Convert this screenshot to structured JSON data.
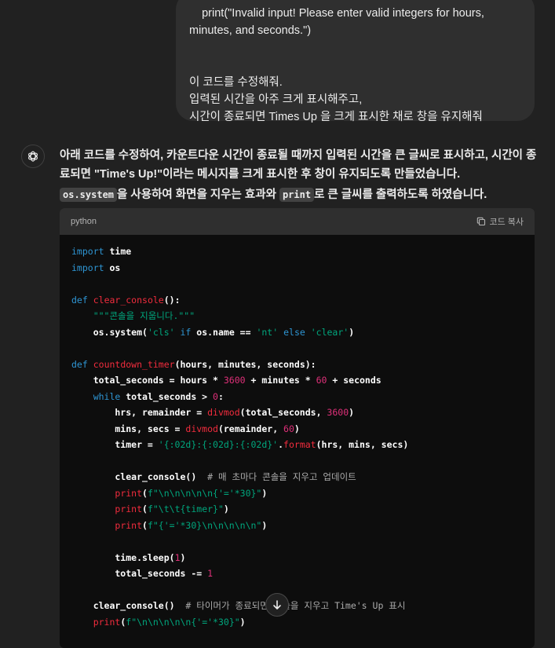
{
  "user_message": {
    "lines": [
      "    print(\"Invalid input! Please enter valid integers for hours,",
      "minutes, and seconds.\")",
      "",
      "",
      "이 코드를 수정해줘.",
      "입력된 시간을 아주 크게 표시해주고,",
      "시간이 종료되면 Times Up 을 크게 표시한 채로 창을 유지해줘"
    ]
  },
  "assistant": {
    "avatar_icon": "openai-logo-icon",
    "para1": "아래 코드를 수정하여, 카운트다운 시간이 종료될 때까지 입력된 시간을 큰 글씨로 표시하고, 시간이 종료되면 \"Time's Up!\"이라는 메시지를 크게 표시한 후 창이 유지되도록 만들었습니다.",
    "para2_code1": "os.system",
    "para2_text1": "을 사용하여 화면을 지우는 효과와 ",
    "para2_code2": "print",
    "para2_text2": "로 큰 글씨를 출력하도록 하였습니다."
  },
  "code_block": {
    "language": "python",
    "copy_label": "코드 복사",
    "lines": [
      [
        [
          "kw",
          "import"
        ],
        [
          "txt",
          " time"
        ]
      ],
      [
        [
          "kw",
          "import"
        ],
        [
          "txt",
          " os"
        ]
      ],
      [],
      [
        [
          "kw",
          "def"
        ],
        [
          "txt",
          " "
        ],
        [
          "fn",
          "clear_console"
        ],
        [
          "txt",
          "():"
        ]
      ],
      [
        [
          "txt",
          "    "
        ],
        [
          "str",
          "\"\"\"콘솔을 지웁니다.\"\"\""
        ]
      ],
      [
        [
          "txt",
          "    os.system("
        ],
        [
          "str",
          "'cls'"
        ],
        [
          "txt",
          " "
        ],
        [
          "kw",
          "if"
        ],
        [
          "txt",
          " os.name == "
        ],
        [
          "str",
          "'nt'"
        ],
        [
          "txt",
          " "
        ],
        [
          "kw",
          "else"
        ],
        [
          "txt",
          " "
        ],
        [
          "str",
          "'clear'"
        ],
        [
          "txt",
          ")"
        ]
      ],
      [],
      [
        [
          "kw",
          "def"
        ],
        [
          "txt",
          " "
        ],
        [
          "fn",
          "countdown_timer"
        ],
        [
          "txt",
          "(hours, minutes, seconds):"
        ]
      ],
      [
        [
          "txt",
          "    total_seconds = hours * "
        ],
        [
          "num",
          "3600"
        ],
        [
          "txt",
          " + minutes * "
        ],
        [
          "num",
          "60"
        ],
        [
          "txt",
          " + seconds"
        ]
      ],
      [
        [
          "txt",
          "    "
        ],
        [
          "kw",
          "while"
        ],
        [
          "txt",
          " total_seconds > "
        ],
        [
          "num",
          "0"
        ],
        [
          "txt",
          ":"
        ]
      ],
      [
        [
          "txt",
          "        hrs, remainder = "
        ],
        [
          "fn",
          "divmod"
        ],
        [
          "txt",
          "(total_seconds, "
        ],
        [
          "num",
          "3600"
        ],
        [
          "txt",
          ")"
        ]
      ],
      [
        [
          "txt",
          "        mins, secs = "
        ],
        [
          "fn",
          "divmod"
        ],
        [
          "txt",
          "(remainder, "
        ],
        [
          "num",
          "60"
        ],
        [
          "txt",
          ")"
        ]
      ],
      [
        [
          "txt",
          "        timer = "
        ],
        [
          "str",
          "'{:02d}:{:02d}:{:02d}'"
        ],
        [
          "txt",
          "."
        ],
        [
          "fn",
          "format"
        ],
        [
          "txt",
          "(hrs, mins, secs)"
        ]
      ],
      [],
      [
        [
          "txt",
          "        clear_console()  "
        ],
        [
          "cm",
          "# 매 초마다 콘솔을 지우고 업데이트"
        ]
      ],
      [
        [
          "txt",
          "        "
        ],
        [
          "fn",
          "print"
        ],
        [
          "txt",
          "("
        ],
        [
          "str",
          "f\"\\n\\n\\n\\n\\n{'='*30}\""
        ],
        [
          "txt",
          ")"
        ]
      ],
      [
        [
          "txt",
          "        "
        ],
        [
          "fn",
          "print"
        ],
        [
          "txt",
          "("
        ],
        [
          "str",
          "f\"\\t\\t{timer}\""
        ],
        [
          "txt",
          ")"
        ]
      ],
      [
        [
          "txt",
          "        "
        ],
        [
          "fn",
          "print"
        ],
        [
          "txt",
          "("
        ],
        [
          "str",
          "f\"{'='*30}\\n\\n\\n\\n\\n\""
        ],
        [
          "txt",
          ")"
        ]
      ],
      [],
      [
        [
          "txt",
          "        time.sleep("
        ],
        [
          "num",
          "1"
        ],
        [
          "txt",
          ")"
        ]
      ],
      [
        [
          "txt",
          "        total_seconds -= "
        ],
        [
          "num",
          "1"
        ]
      ],
      [],
      [
        [
          "txt",
          "    clear_console()  "
        ],
        [
          "cm",
          "# 타이머가 종료되면 콘솔을 지우고 Time's Up 표시"
        ]
      ],
      [
        [
          "txt",
          "    "
        ],
        [
          "fn",
          "print"
        ],
        [
          "txt",
          "("
        ],
        [
          "str",
          "f\"\\n\\n\\n\\n\\n{'='*30}\""
        ],
        [
          "txt",
          ")"
        ]
      ]
    ]
  },
  "scroll_button": {
    "icon": "arrow-down-icon"
  }
}
